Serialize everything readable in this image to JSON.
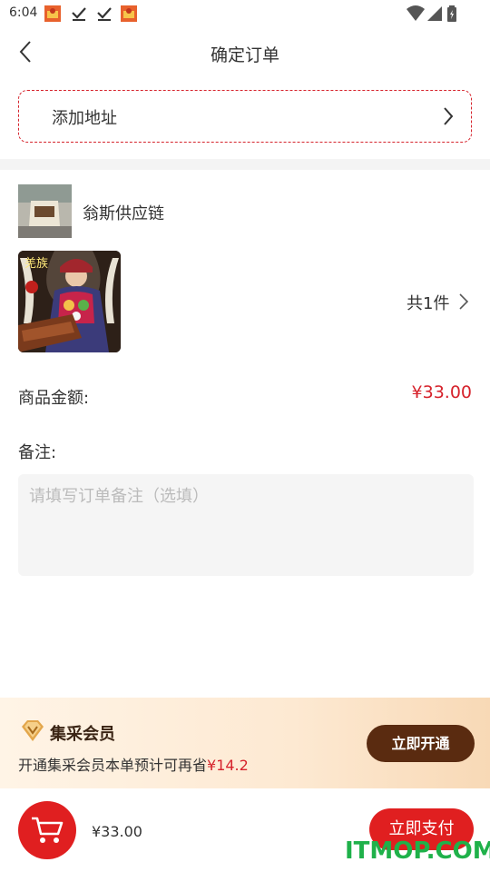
{
  "status_bar": {
    "time": "6:04",
    "notification_icons": [
      "app-notification-icon",
      "download-done-icon",
      "download-done-icon",
      "app-notification-icon"
    ],
    "right_icons": [
      "wifi-icon",
      "signal-icon",
      "battery-icon"
    ]
  },
  "nav": {
    "title": "确定订单",
    "back_icon": "chevron-left-icon"
  },
  "address": {
    "label": "添加地址",
    "border_color": "#d6232c"
  },
  "shop": {
    "name": "翁斯供应链"
  },
  "product": {
    "image_text": "羌族",
    "count_label": "共1件"
  },
  "order": {
    "amount_label": "商品金额:",
    "amount_value": "¥33.00"
  },
  "remark": {
    "label": "备注:",
    "placeholder": "请填写订单备注（选填）"
  },
  "membership": {
    "title": "集采会员",
    "desc_prefix": "开通集采会员本单预计可再省",
    "desc_amount": "¥14.2",
    "button_label": "立即开通"
  },
  "bottom_bar": {
    "total": "¥33.00",
    "pay_label": "立即支付"
  },
  "watermark": "ITMOP.COM",
  "colors": {
    "accent": "#e01f20",
    "price": "#d6232c",
    "vip_button": "#5a2b10",
    "watermark": "#1fb14a"
  }
}
